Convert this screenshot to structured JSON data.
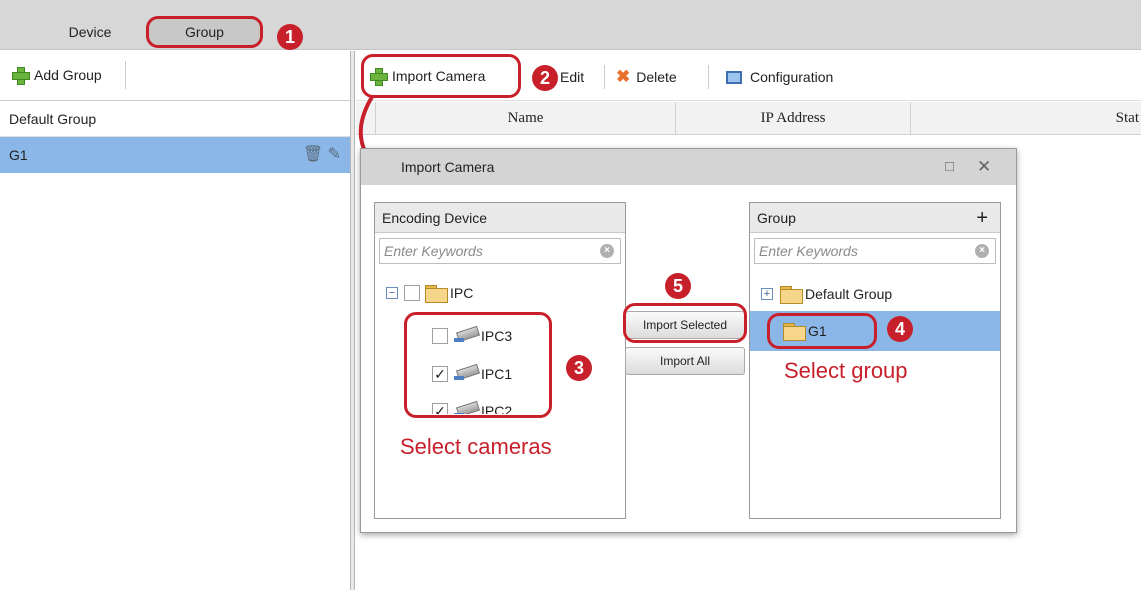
{
  "tabs": {
    "device": "Device",
    "group": "Group"
  },
  "badges": {
    "b1": "1",
    "b2": "2",
    "b3": "3",
    "b4": "4",
    "b5": "5"
  },
  "left_panel": {
    "add_group": "Add Group",
    "items": [
      {
        "label": "Default Group"
      },
      {
        "label": "G1"
      }
    ]
  },
  "toolbar": {
    "import_camera": "Import Camera",
    "edit": "Edit",
    "delete": "Delete",
    "configuration": "Configuration"
  },
  "table": {
    "columns": [
      "Name",
      "IP Address",
      "Stat"
    ]
  },
  "dialog": {
    "title": "Import Camera",
    "encoding_pane": {
      "title": "Encoding Device",
      "search_placeholder": "Enter Keywords",
      "root": "IPC",
      "children": [
        {
          "label": "IPC3",
          "checked": false
        },
        {
          "label": "IPC1",
          "checked": true
        },
        {
          "label": "IPC2",
          "checked": true
        }
      ]
    },
    "group_pane": {
      "title": "Group",
      "search_placeholder": "Enter Keywords",
      "items": [
        {
          "label": "Default Group"
        },
        {
          "label": "G1"
        }
      ]
    },
    "import_selected": "Import Selected",
    "import_all": "Import All"
  },
  "annotations": {
    "select_cameras": "Select cameras",
    "select_group": "Select group"
  },
  "colors": {
    "accent_red": "#c8202a",
    "selection_blue": "#8ab7e8",
    "toolbar_gray": "#d7d7d7"
  }
}
